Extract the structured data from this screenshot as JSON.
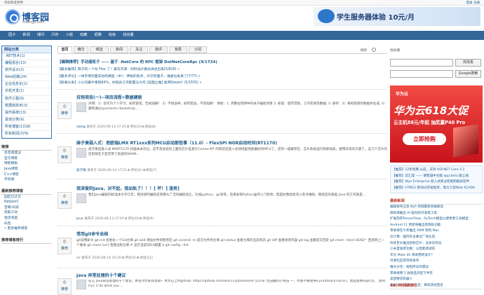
{
  "topbar": {
    "left": "代码改变世界",
    "right_login": "登录",
    "right_register": "注册"
  },
  "header": {
    "logo_title": "博客园",
    "logo_sub": "cnblogs.com",
    "banner_text": "学生服务器体验 10元/月"
  },
  "nav": [
    "园子",
    "新闻",
    "博问",
    "闪存",
    "小组",
    "收藏",
    "招聘",
    "班级",
    "找找看"
  ],
  "sidebar": {
    "category_title": "网站分类",
    "categories": [
      ".NET技术(1)",
      "编程语言(13)",
      "软件设计(2)",
      "Web前端(24)",
      "企业信息化(2)",
      "手机开发(1)",
      "软件工程(9)",
      "数据库技术(3)",
      "操作系统(13)",
      "其他分类(9)",
      "所有博客(1318)",
      "所有新闻(379)"
    ],
    "links_title": "链接",
    "links": [
      "反馈或建议",
      "官方博客",
      "博客模板",
      "Java博客",
      "C++博客",
      "手机版"
    ],
    "recent_title": "最新推荐博客",
    "recent": [
      "园区已迁云",
      "NetJamC",
      "百箱-科技",
      "高能工坊",
      "恒流测度",
      "彩色",
      "» 更多推荐博客"
    ],
    "rank_title": "推荐博客排行"
  },
  "tabs": [
    "首页",
    "精华",
    "候选",
    "新闻",
    "关注",
    "我评",
    "我赞",
    "订阅"
  ],
  "tab_right": "刷新",
  "featured": {
    "title": "【编辑推荐】手动造轮子 —— 基于 .NetCore 的 RPC 框架 DotNetCoreRpc (9/1724)",
    "lines": [
      "【最多推荐】院子有一个叫 Flex 了！再写开源：同时设计模式讲述出来(5/828) »",
      "【最多评论】一样字母的面向你的模型（中）：神秘的技术，外交的面子，谦虚也发来了(7/77) »",
      "【新闻头条】小公司最牛掌管84%，你如此工作配置与大作 [蓝图之推] 复用Steam! (5/1555) »"
    ]
  },
  "posts": [
    {
      "digg": "0",
      "digg_label": "推荐",
      "title": "拉钩项目(一)--项目流程+数据建联",
      "summary": "声明：1）仅作为个人学习，如有冒犯，告知速删！ 2）不想误导，如有错误，不吝指教！ 目标：1. 完整拉钩网中的关于编程项目 2. 抓取：城市范围、工作年限等数据; 3. 保存：3）将抓取到的数据并生成; 4）最终通过zyecharts+bootstrap...",
      "author": "xblog",
      "meta": "发布于 2020-06-14 17:25",
      "comments": "评论(0)",
      "views": "阅读(8)",
      "thumb": true
    },
    {
      "digg": "0",
      "digg_label": "推荐",
      "title": "麻子衰弱入式：思欧瑞LMX RT1xxx系列MCU启动那些事（11.0）- FlexSPI NOR启动时间(RT1170)",
      "summary": "痞子衡说嵌入式 MXRT1170 扫描本本识记，这不及痞说的上面的芯片是基于Cortex-M7 的目前在嵌入式领域里性能最好的MCU了，还有一级缓存区，芯片系统运行频率很高，使用非常的方便了，这几个芯片的区别就在于是否带了高速的SRAM...",
      "author": "痞子衡",
      "meta": "发布于 2020-06-14 17:21",
      "comments": "评论(0)",
      "views": "阅读(7)",
      "thumb": true
    },
    {
      "digg": "0",
      "digg_label": "推荐",
      "title": "我深爱的Java，对不起，我出轨了！！！[ 坏！] 渣男]",
      "summary": "我们Java编程的标准本大学几年，我没想的编程还有那么广泛的编程语言，比如python，go等等，后来发现Python虽然入门简单，但是好像后续深入有点难呢，我现在的基础 Java 的工作就是...",
      "author": "Java",
      "meta": "发布于 2020-06-14 17:01",
      "comments": "评论(0)",
      "views": "阅读(9)",
      "thumb": true
    },
    {
      "digg": "0",
      "digg_label": "推荐",
      "title": "常用git命令总结",
      "summary": "git常用命令 git init 初始化一个Git仓库 git add 添加文件到暂存区 git commit -m 提交文件到仓库 git status 查看仓库的当前状态 git diff 查看修改内容 git log 查看提交历史 git reset --hard HEAD^ 回退到上一个版本 git clone [url] 克隆远程仓库 # 显示当前的Git配置 $ git config --list",
      "author": "rrr",
      "meta": "发布于 2020-06-14 16:20",
      "comments": "评论(0)",
      "views": "阅读(12)",
      "thumb": false
    },
    {
      "digg": "0",
      "digg_label": "推荐",
      "title": "Java 异常处理的十个建议",
      "summary": "前言 Java异常处理的十个建议，希望对大家有帮助~ 本文已上传github: https://github.com/whx123/JavaHome 公众号: 捡田螺的小男孩 一、尽量不要使用e.printStackTrace()，而是使用log打印。 反例: try{ // do what you ...",
      "author": "",
      "meta": "",
      "comments": "",
      "views": "",
      "thumb": true
    }
  ],
  "right": {
    "search_label": "找找看",
    "search_button": "找找看",
    "google_button": "Google搜索",
    "ad": {
      "brand": "华为云",
      "headline": "华为云618大促",
      "sub": "云主机88元/年起 抽奖赢P40 Pro",
      "button": "立即抢购"
    },
    "notices": [
      "【推荐】12年经典 从前，支持 ASP.NET Core 3.1",
      "【推荐】云汇成 —— 博客园中文版 app beta 版上线",
      "【推荐】Wyn Enterprise 嵌入式商业智能和报表软件",
      "【推荐】HTML5 移动UI开发框架，电力工控Web SCADA"
    ],
    "news_title": "最新新闻",
    "news": [
      "编辑发布信息 NLP 领域最新进展解读",
      "微软将推出 AI 驱动的开发者工具",
      "扩展现有TensorFlow、PyTorch模型以便更新工具模型",
      "Android 11 更新将推出新隐私功能",
      "苹果将在今年推出 ARM 架构 Mac",
      "云计算：国内外主要云厂商比较",
      "科技巨头推出新款芯片，竞争白热化",
      "小米首发新功能：以后能测试的",
      "华为 Mate 40 将采用新设计？",
      "开源社区新项目发布",
      "推文分享：给程序员的建议",
      "苹果将用 5 款新品开启下半年",
      "美团要造机器人",
      "安卓 P55 发布会之后：真机测试回答",
      "》更多新闻..."
    ],
    "hot_title": "48小时阅读排行"
  }
}
